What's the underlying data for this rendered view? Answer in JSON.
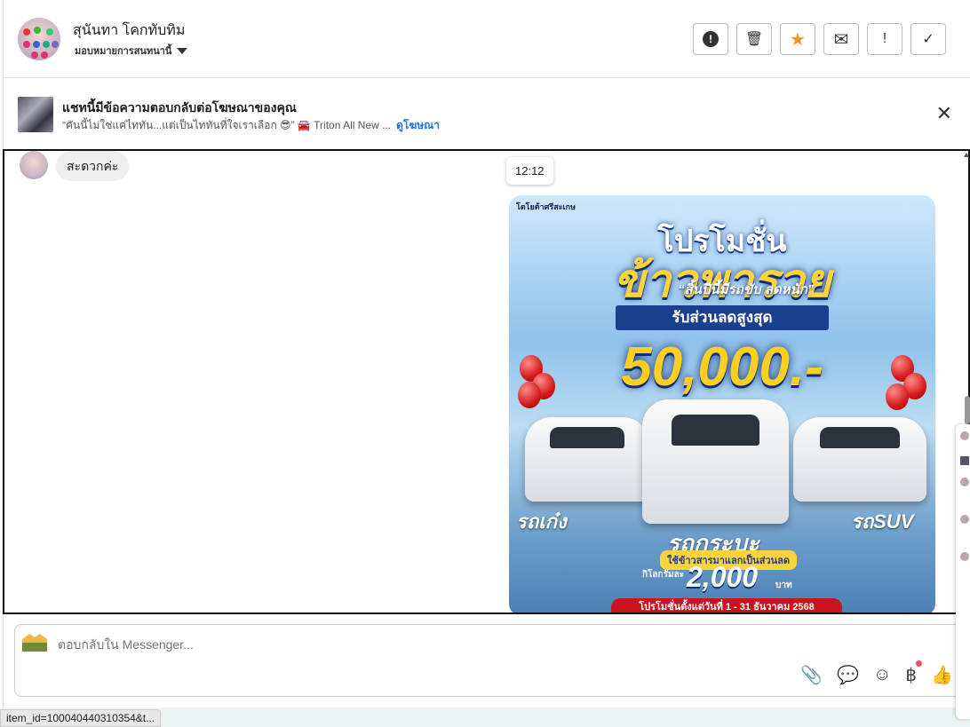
{
  "header": {
    "contact_name": "สุนันทา โคกทับทิม",
    "assign_label": "มอบหมายการสนทนานี้",
    "actions": [
      {
        "name": "spam-button",
        "icon": "!"
      },
      {
        "name": "delete-button",
        "icon": "🗑"
      },
      {
        "name": "star-button",
        "icon": "★"
      },
      {
        "name": "mark-unread-button",
        "icon": "✉"
      },
      {
        "name": "follow-up-button",
        "icon": "!"
      },
      {
        "name": "done-button",
        "icon": "✓"
      }
    ],
    "star_color": "#f7931e"
  },
  "ad_banner": {
    "title": "แชทนี้มีข้อความตอบกลับต่อโฆษณาของคุณ",
    "snippet": "“คันนี้ไม่ใช่แค่ไททัน...แต่เป็นไททันที่ใจเราเลือก 😎” 🚘 Triton All New ...",
    "link": "ดูโฆษณา"
  },
  "thread": {
    "incoming_message": "สะดวกค่ะ",
    "timestamp": "12:12",
    "poster": {
      "brand": "โตโยต้าศรีสะเกษ",
      "promo": "โปรโมชั่น",
      "headline": "ข้าวพารวย",
      "slogan": "“สิ้นปีนี้มีรถขับ ลดหนัก”",
      "band": "รับส่วนลดสูงสุด",
      "amount": "50,000.-",
      "label_sedan": "รถเก๋ง",
      "label_pickup": "รถกระบะ",
      "label_suv": "รถSUV",
      "swap": "ใช้ข้าวสารมาแลกเป็นส่วนลด",
      "per_kg": "กิโลกรัมละ",
      "per_kg_value": "2,000",
      "baht": "บาท",
      "dates": "โปรโมชั่นตั้งแต่วันที่ 1 - 31 ธันวาคม 2568"
    }
  },
  "composer": {
    "placeholder": "ตอบกลับใน Messenger...",
    "tools": {
      "attach": "📎",
      "saved_reply": "💬",
      "emoji": "☺",
      "payment": "฿",
      "like": "👍"
    }
  },
  "status_bar": "item_id=100040440310354&t..."
}
